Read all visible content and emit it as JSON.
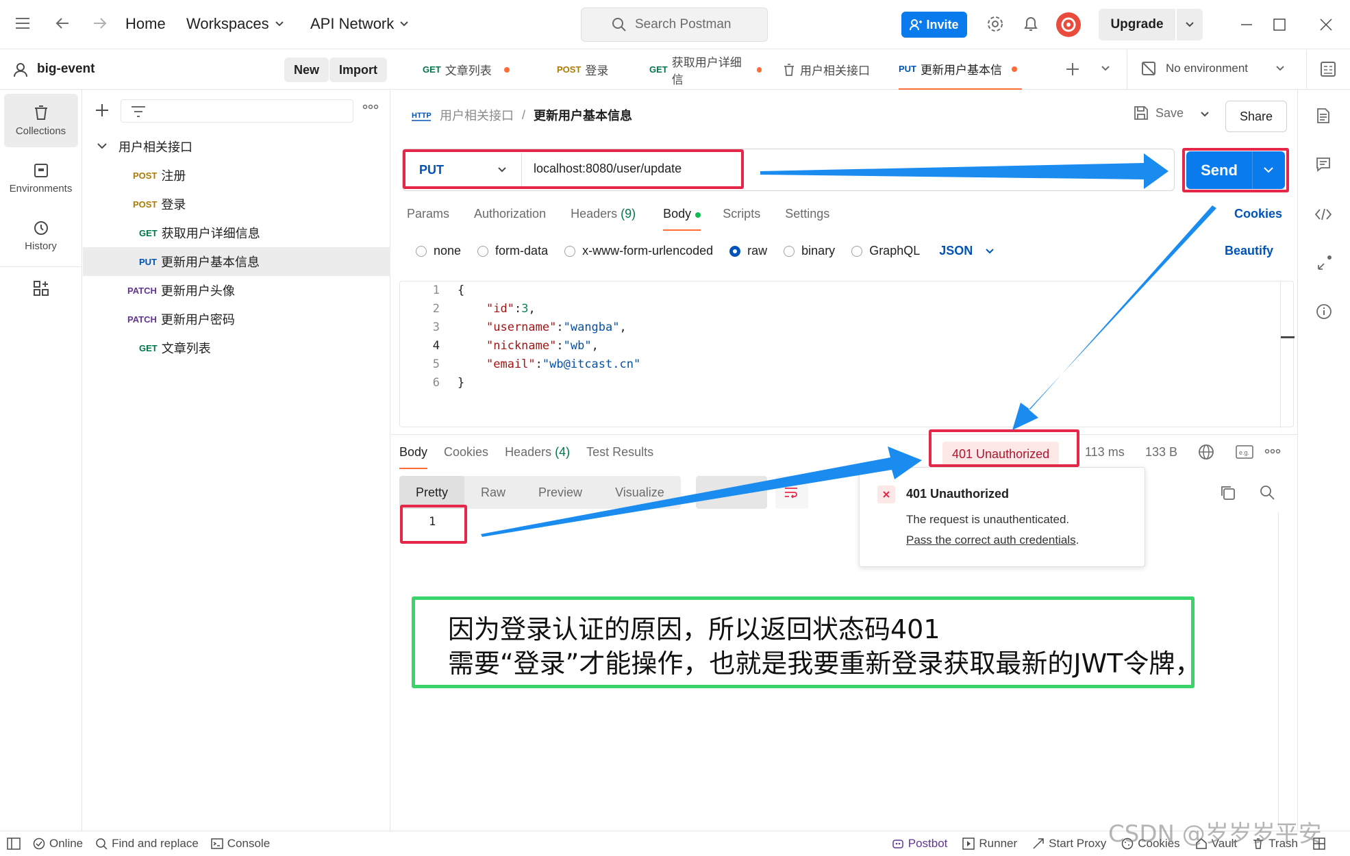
{
  "topbar": {
    "nav": [
      "Home",
      "Workspaces",
      "API Network"
    ],
    "search_placeholder": "Search Postman",
    "invite_label": "Invite",
    "upgrade_label": "Upgrade"
  },
  "workspace": {
    "name": "big-event",
    "new_label": "New",
    "import_label": "Import"
  },
  "rail": [
    {
      "label": "Collections",
      "icon": "collections-icon",
      "active": true
    },
    {
      "label": "Environments",
      "icon": "environments-icon"
    },
    {
      "label": "History",
      "icon": "history-icon"
    }
  ],
  "collection": {
    "name": "用户相关接口",
    "items": [
      {
        "method": "POST",
        "name": "注册"
      },
      {
        "method": "POST",
        "name": "登录"
      },
      {
        "method": "GET",
        "name": "获取用户详细信息"
      },
      {
        "method": "PUT",
        "name": "更新用户基本信息",
        "selected": true
      },
      {
        "method": "PATCH",
        "name": "更新用户头像"
      },
      {
        "method": "PATCH",
        "name": "更新用户密码"
      },
      {
        "method": "GET",
        "name": "文章列表"
      }
    ]
  },
  "tabs": [
    {
      "method": "GET",
      "name": "文章列表",
      "dirty": true
    },
    {
      "method": "POST",
      "name": "登录"
    },
    {
      "method": "GET",
      "name": "获取用户详细信",
      "dirty": true
    },
    {
      "method": "",
      "name": "用户相关接口"
    },
    {
      "method": "PUT",
      "name": "更新用户基本信",
      "dirty": true,
      "active": true
    }
  ],
  "environment": "No environment",
  "breadcrumb": {
    "parent": "用户相关接口",
    "current": "更新用户基本信息"
  },
  "save_label": "Save",
  "share_label": "Share",
  "request": {
    "method": "PUT",
    "url": "localhost:8080/user/update",
    "send_label": "Send",
    "subtabs": [
      "Params",
      "Authorization",
      "Headers",
      "(9)",
      "Body",
      "Scripts",
      "Settings"
    ],
    "cookies_label": "Cookies",
    "body_types": [
      "none",
      "form-data",
      "x-www-form-urlencoded",
      "raw",
      "binary",
      "GraphQL"
    ],
    "body_format": "JSON",
    "beautify_label": "Beautify",
    "line_numbers": [
      "1",
      "2",
      "3",
      "4",
      "5",
      "6"
    ],
    "code": {
      "open": "{",
      "lines": [
        {
          "key": "\"id\"",
          "sep": ":",
          "val": "3",
          "tail": ","
        },
        {
          "key": "\"username\"",
          "sep": ":",
          "val": "\"wangba\"",
          "tail": ","
        },
        {
          "key": "\"nickname\"",
          "sep": ":",
          "val": "\"wb\"",
          "tail": ","
        },
        {
          "key": "\"email\"",
          "sep": ":",
          "val": "\"wb@itcast.cn\"",
          "tail": ""
        }
      ],
      "close": "}"
    }
  },
  "response": {
    "tabs": [
      "Body",
      "Cookies",
      "Headers",
      "(4)",
      "Test Results"
    ],
    "status": "401 Unauthorized",
    "time": "113 ms",
    "size": "133 B",
    "views": [
      "Pretty",
      "Raw",
      "Preview",
      "Visualize"
    ],
    "line": "1",
    "tooltip": {
      "title": "401 Unauthorized",
      "desc": "The request is unauthenticated.",
      "link": "Pass the correct auth credentials",
      "link_tail": "."
    }
  },
  "annotation": {
    "line1": "因为登录认证的原因，所以返回状态码401",
    "line2": "需要“登录”才能操作，也就是我要重新登录获取最新的JWT令牌，"
  },
  "statusbar": {
    "left": [
      "Online",
      "Find and replace",
      "Console"
    ],
    "right": [
      "Postbot",
      "Runner",
      "Start Proxy",
      "Cookies",
      "Vault",
      "Trash"
    ]
  },
  "watermark": "CSDN @岁岁岁平安",
  "colors": {
    "accent": "#ff6c37",
    "send": "#097bed",
    "red_box": "#e5284a",
    "green_box": "#3bd46b",
    "arrow": "#1a8cf0"
  }
}
